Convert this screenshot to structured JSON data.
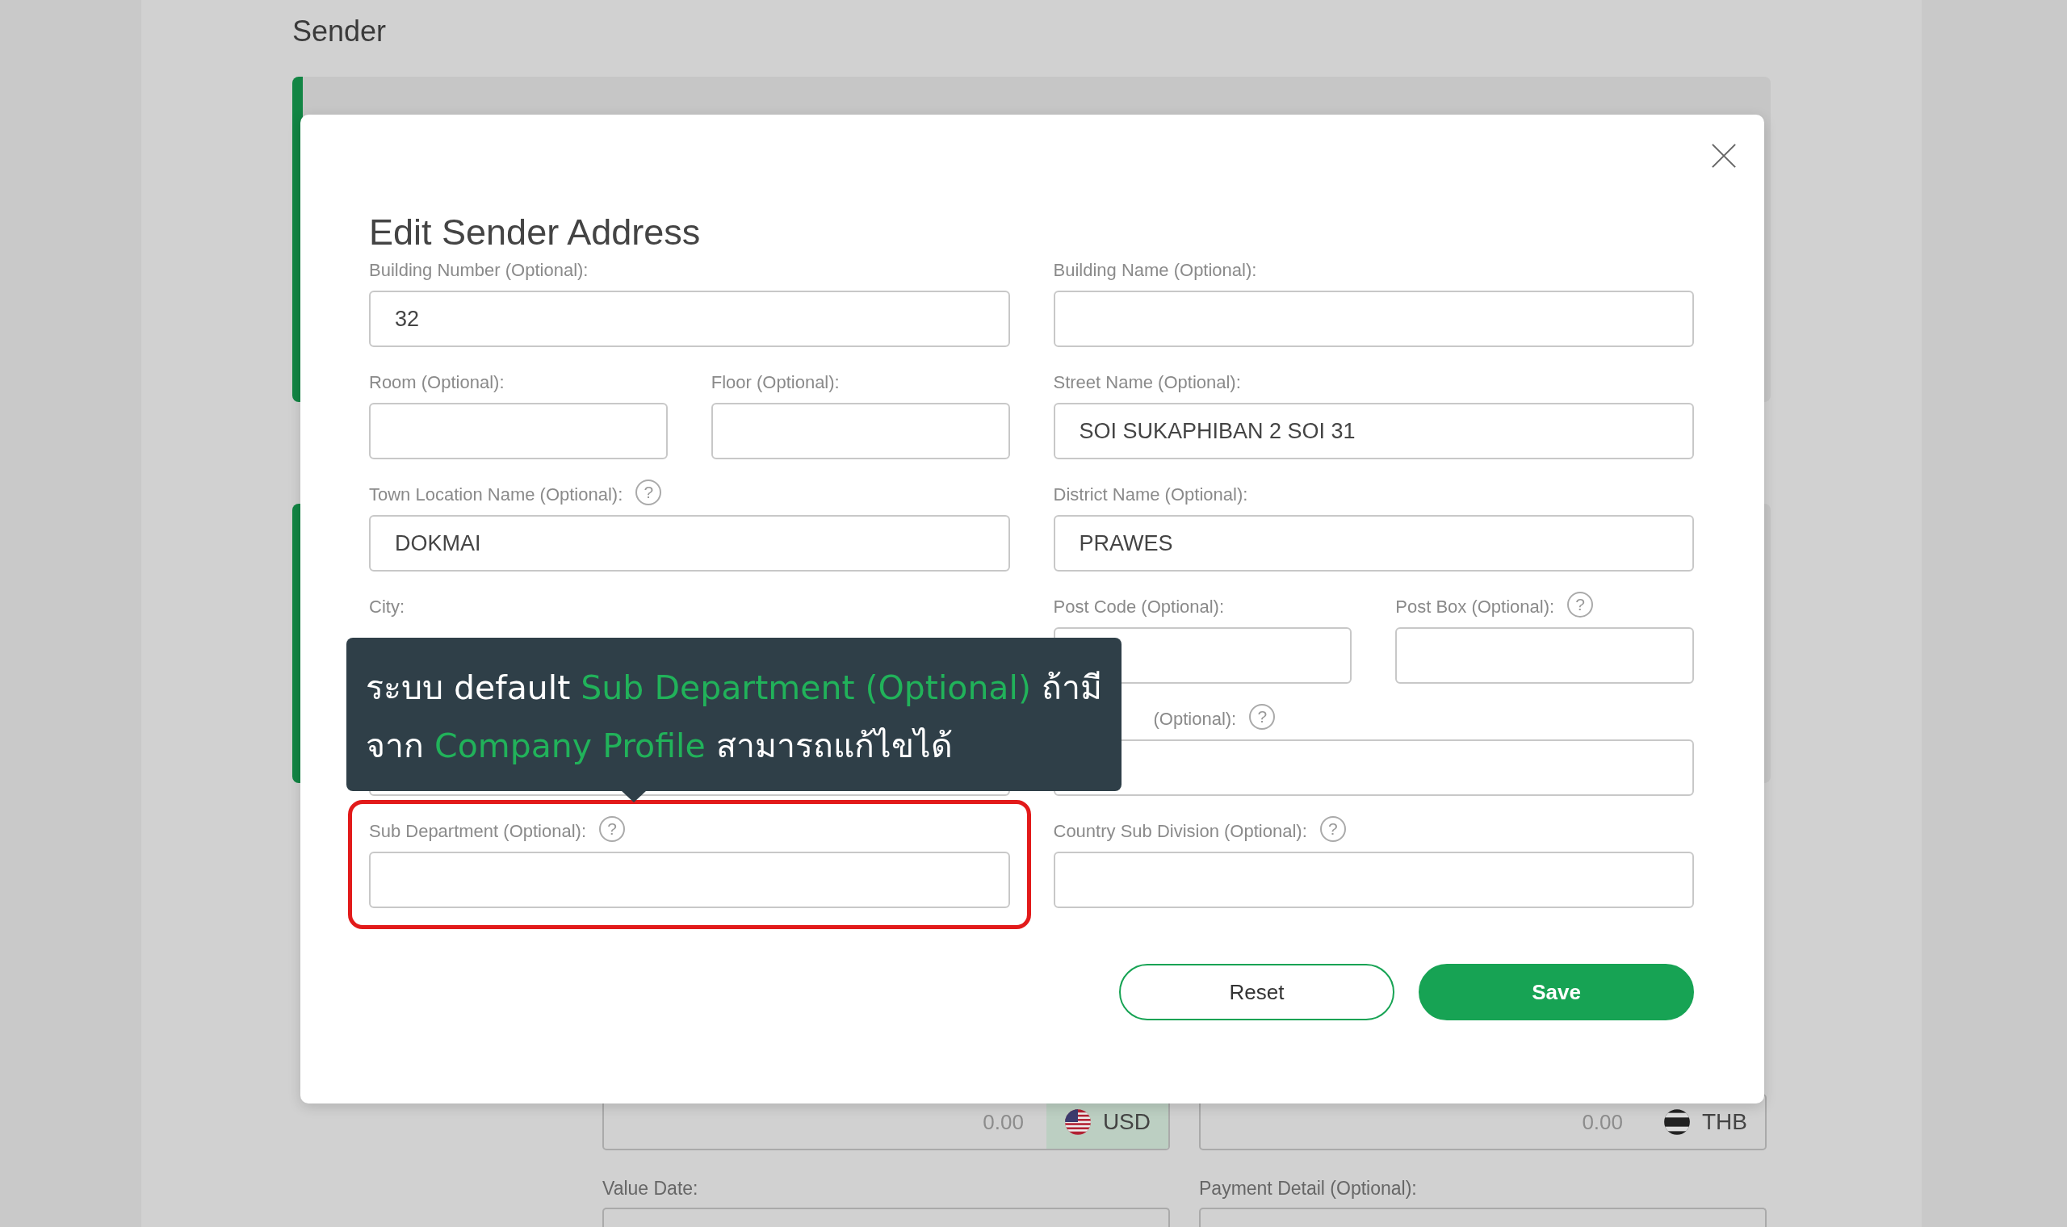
{
  "page": {
    "title": "Sender",
    "amounts": [
      {
        "value": "0.00",
        "currency": "USD",
        "highlighted": true
      },
      {
        "value": "0.00",
        "currency": "THB",
        "highlighted": false
      }
    ],
    "labels": [
      "Value Date:",
      "Payment Detail (Optional):"
    ]
  },
  "modal": {
    "title": "Edit Sender Address",
    "rows": [
      {
        "columns": [
          {
            "fields": [
              {
                "label": "Building Number (Optional):",
                "value": "32"
              }
            ]
          },
          {
            "fields": [
              {
                "label": "Building Name (Optional):"
              }
            ]
          }
        ]
      },
      {
        "columns": [
          {
            "fields": [
              {
                "label": "Room (Optional):"
              },
              {
                "label": "Floor (Optional):"
              }
            ]
          },
          {
            "fields": [
              {
                "label": "Street Name (Optional):",
                "value": "SOI SUKAPHIBAN 2 SOI 31"
              }
            ]
          }
        ]
      },
      {
        "columns": [
          {
            "fields": [
              {
                "label": "Town Location Name (Optional):",
                "value": "DOKMAI",
                "help": "?"
              }
            ]
          },
          {
            "fields": [
              {
                "label": "District Name (Optional):",
                "value": "PRAWES"
              }
            ]
          }
        ]
      },
      {
        "columns": [
          {
            "fields": [
              {
                "label": "City:",
                "input_hidden": true
              }
            ]
          },
          {
            "fields": [
              {
                "label": "Post Code (Optional):"
              },
              {
                "label": "Post Box (Optional):",
                "help": "?"
              }
            ]
          }
        ]
      },
      {
        "columns": [
          {
            "fields": [
              {
                "label_hidden": true
              }
            ]
          },
          {
            "fields": [
              {
                "label": "(Optional):",
                "help": "?",
                "label_cut": true
              }
            ]
          }
        ]
      },
      {
        "columns": [
          {
            "fields": [
              {
                "label": "Sub Department (Optional):",
                "help": "?",
                "highlighted": true
              }
            ]
          },
          {
            "fields": [
              {
                "label": "Country Sub Division (Optional):",
                "help": "?"
              }
            ]
          }
        ]
      }
    ],
    "buttons": [
      {
        "label": "Reset",
        "kind": "secondary"
      },
      {
        "label": "Save",
        "kind": "primary"
      }
    ],
    "tooltip": {
      "lines": [
        [
          {
            "text": "ระบบ default ",
            "accent": false
          },
          {
            "text": "Sub Department (Optional)",
            "accent": true
          },
          {
            "text": " ถ้ามี",
            "accent": false
          }
        ],
        [
          {
            "text": "จาก ",
            "accent": false
          },
          {
            "text": "Company Profile",
            "accent": true
          },
          {
            "text": " สามารถแก้ไขได้",
            "accent": false
          }
        ]
      ]
    }
  }
}
